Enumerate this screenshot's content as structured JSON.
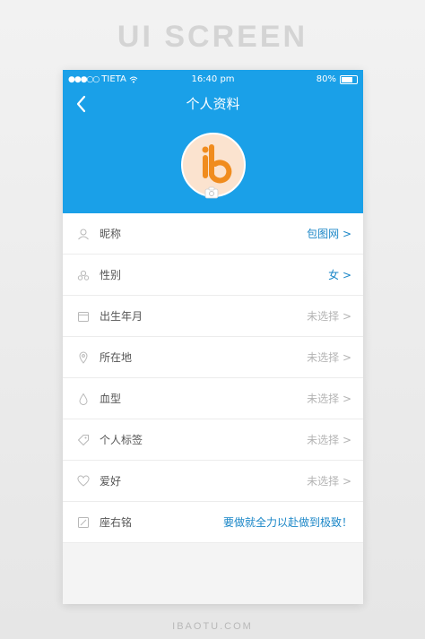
{
  "banner": {
    "title": "UI SCREEN"
  },
  "status_bar": {
    "carrier": "TIETA",
    "time": "16:40 pm",
    "battery": "80%"
  },
  "nav": {
    "title": "个人资料"
  },
  "avatar": {
    "logo_letters": "ib"
  },
  "profile": {
    "rows": [
      {
        "label": "昵称",
        "value": "包图网 >",
        "icon": "user-icon"
      },
      {
        "label": "性别",
        "value": "女 >",
        "icon": "gender-icon"
      },
      {
        "label": "出生年月",
        "value": "未选择 >",
        "icon": "calendar-icon"
      },
      {
        "label": "所在地",
        "value": "未选择 >",
        "icon": "location-pin-icon"
      },
      {
        "label": "血型",
        "value": "未选择 >",
        "icon": "blood-drop-icon"
      },
      {
        "label": "个人标签",
        "value": "未选择 >",
        "icon": "tag-icon"
      },
      {
        "label": "爱好",
        "value": "未选择 >",
        "icon": "heart-icon"
      },
      {
        "label": "座右铭",
        "value": "要做就全力以赴做到极致！",
        "icon": "edit-icon"
      }
    ]
  },
  "footer": {
    "site": "IBAOTU.COM"
  },
  "colors": {
    "primary": "#1aa0e8",
    "value_set": "#1a86c7",
    "value_unset": "#b4b4b4",
    "avatar_orange": "#f08c1e"
  }
}
